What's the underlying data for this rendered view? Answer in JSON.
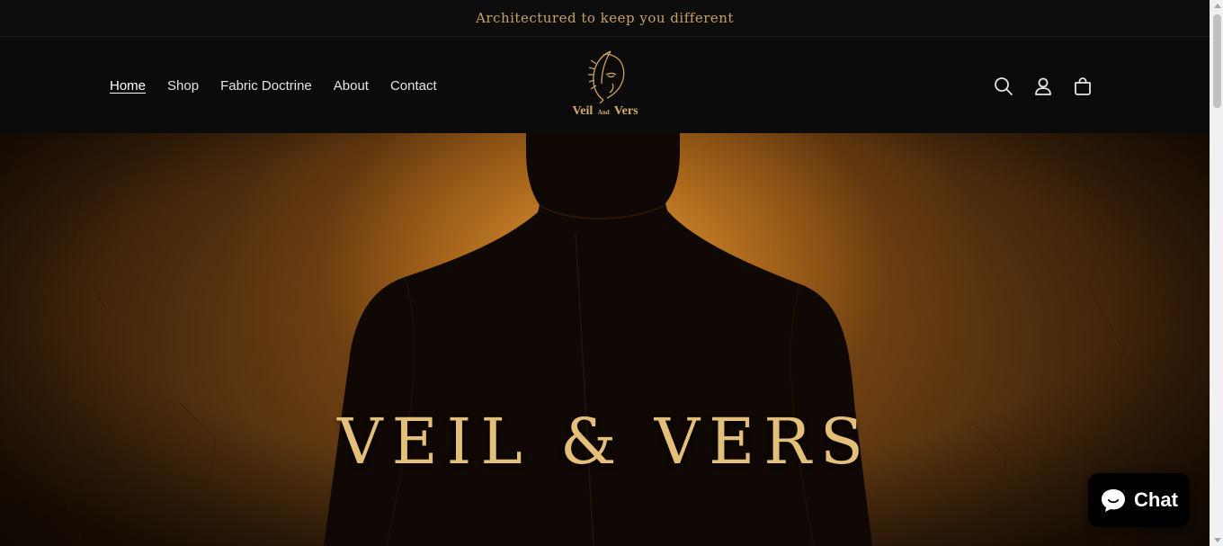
{
  "announcement": {
    "text": "Architectured to keep you different"
  },
  "nav": {
    "items": [
      {
        "label": "Home",
        "active": true
      },
      {
        "label": "Shop"
      },
      {
        "label": "Fabric Doctrine"
      },
      {
        "label": "About"
      },
      {
        "label": "Contact"
      }
    ]
  },
  "logo": {
    "word1": "Veil",
    "word_small": "And",
    "word2": "Vers"
  },
  "header_icons": [
    "search-icon",
    "account-icon",
    "cart-icon"
  ],
  "hero": {
    "title": "VEIL & VERS"
  },
  "chat": {
    "label": "Chat",
    "icon": "chat-bubble-icon"
  },
  "colors": {
    "accent": "#c9a063",
    "background": "#0b0b0b",
    "hero_glow": "#e8a03c"
  }
}
